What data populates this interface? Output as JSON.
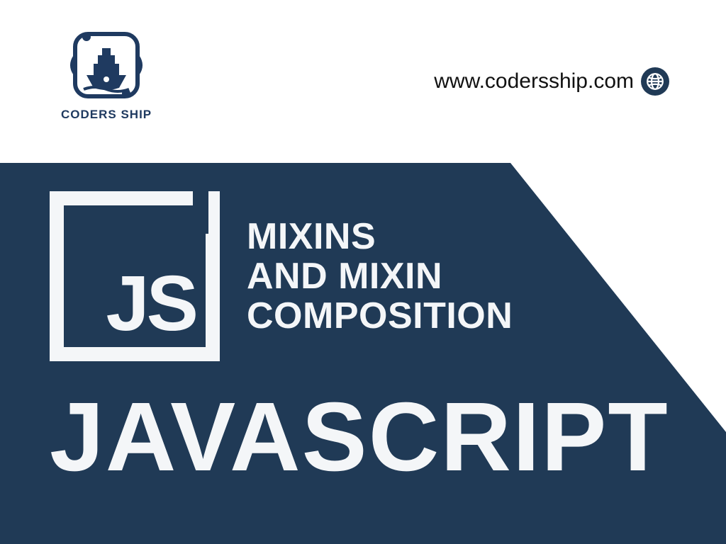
{
  "brand": {
    "name": "CODERS SHIP",
    "url": "www.codersship.com"
  },
  "accent_color": "#203a56",
  "logo_color": "#1f3a60",
  "content": {
    "js_badge": "JS",
    "subtitle_line1": "MIXINS",
    "subtitle_line2": "AND MIXIN",
    "subtitle_line3": "COMPOSITION",
    "language": "JAVASCRIPT"
  },
  "icons": {
    "globe": "globe-icon",
    "ship_logo": "ship-logo-icon"
  }
}
